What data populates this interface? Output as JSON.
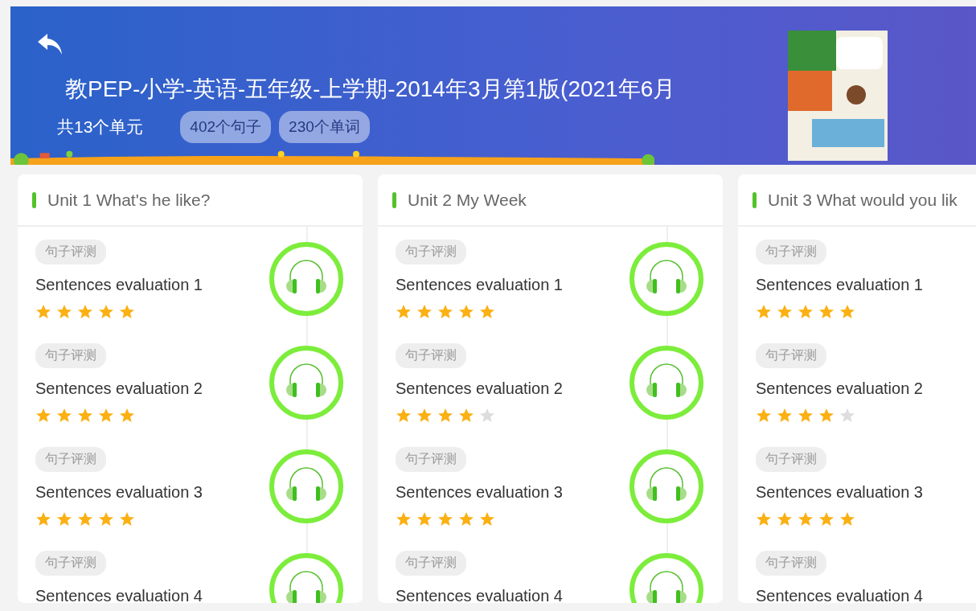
{
  "header": {
    "title": "教PEP-小学-英语-五年级-上学期-2014年3月第1版(2021年6月",
    "unit_count": "共13个单元",
    "badges": [
      "402个句子",
      "230个单词"
    ]
  },
  "units": [
    {
      "title": "Unit 1 What's he like?",
      "items": [
        {
          "tag": "句子评测",
          "title": "Sentences evaluation 1",
          "stars": 5
        },
        {
          "tag": "句子评测",
          "title": "Sentences evaluation 2",
          "stars": 5
        },
        {
          "tag": "句子评测",
          "title": "Sentences evaluation 3",
          "stars": 5
        },
        {
          "tag": "句子评测",
          "title": "Sentences evaluation 4"
        }
      ]
    },
    {
      "title": "Unit 2 My Week",
      "items": [
        {
          "tag": "句子评测",
          "title": "Sentences evaluation 1",
          "stars": 5
        },
        {
          "tag": "句子评测",
          "title": "Sentences evaluation 2",
          "stars": 4
        },
        {
          "tag": "句子评测",
          "title": "Sentences evaluation 3",
          "stars": 5
        },
        {
          "tag": "句子评测",
          "title": "Sentences evaluation 4"
        }
      ]
    },
    {
      "title": "Unit 3 What would you lik",
      "items": [
        {
          "tag": "句子评测",
          "title": "Sentences evaluation 1",
          "stars": 5
        },
        {
          "tag": "句子评测",
          "title": "Sentences evaluation 2",
          "stars": 4
        },
        {
          "tag": "句子评测",
          "title": "Sentences evaluation 3",
          "stars": 5
        },
        {
          "tag": "句子评测",
          "title": "Sentences evaluation 4"
        }
      ]
    }
  ]
}
